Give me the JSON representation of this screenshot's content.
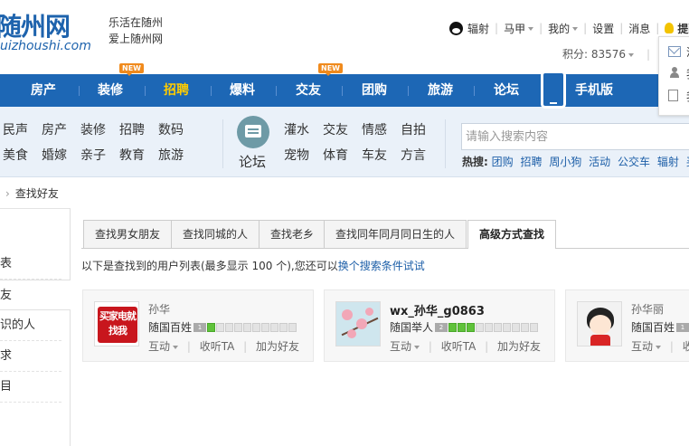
{
  "header": {
    "logo_main": "随州网",
    "logo_sub": "uizhoushi.com",
    "slogan_line1": "乐活在随州",
    "slogan_line2": "爱上随州网",
    "user": {
      "qq_name": "辐射",
      "username": "马甲",
      "mine": "我的",
      "settings": "设置",
      "messages": "消息",
      "reminder": "提醒",
      "points": "积分: 83576"
    },
    "dropdown": {
      "item1": "消",
      "item2": "我",
      "item3": "我"
    }
  },
  "nav": {
    "items": [
      {
        "label": "房产"
      },
      {
        "label": "装修",
        "badge": "NEW"
      },
      {
        "label": "招聘",
        "active": true
      },
      {
        "label": "爆料"
      },
      {
        "label": "交友",
        "badge": "NEW"
      },
      {
        "label": "团购"
      },
      {
        "label": "旅游"
      },
      {
        "label": "论坛"
      },
      {
        "label": "手机版"
      }
    ]
  },
  "subnav": {
    "row1": [
      "民声",
      "房产",
      "装修",
      "招聘",
      "数码"
    ],
    "row2": [
      "美食",
      "婚嫁",
      "亲子",
      "教育",
      "旅游"
    ],
    "forum_label": "论坛",
    "forum_row1": [
      "灌水",
      "交友",
      "情感",
      "自拍"
    ],
    "forum_row2": [
      "宠物",
      "体育",
      "车友",
      "方言"
    ],
    "search_placeholder": "请输入搜索内容",
    "hot_label": "热搜:",
    "hot_links": [
      "团购",
      "招聘",
      "周小狗",
      "活动",
      "公交车",
      "辐射",
      "买房"
    ]
  },
  "breadcrumb": {
    "sep": "›",
    "current": "查找好友"
  },
  "sidebar": {
    "items": [
      {
        "label": "表"
      },
      {
        "label": "友",
        "active": true
      },
      {
        "label": "识的人"
      },
      {
        "label": "求"
      },
      {
        "label": "目"
      }
    ]
  },
  "tabs": [
    {
      "label": "查找男女朋友"
    },
    {
      "label": "查找同城的人"
    },
    {
      "label": "查找老乡"
    },
    {
      "label": "查找同年同月同日生的人"
    },
    {
      "label": "高级方式查找",
      "active": true
    }
  ],
  "result_note": {
    "text": "以下是查找到的用户列表(最多显示 100 个),您还可以",
    "link": "换个搜索条件试试"
  },
  "users": [
    {
      "name": "孙华",
      "rank": "随国百姓",
      "level": "1",
      "level_fill": 0.1,
      "avatar_text": "买家电就找我",
      "action_interact": "互动",
      "action_follow": "收听TA",
      "action_add": "加为好友"
    },
    {
      "name": "wx_孙华_g0863",
      "rank": "随国举人",
      "level": "2",
      "level_fill": 0.3,
      "action_interact": "互动",
      "action_follow": "收听TA",
      "action_add": "加为好友"
    },
    {
      "name": "孙华丽",
      "rank": "随国百姓",
      "level": "1",
      "action_interact": "互动",
      "action_follow": "收"
    }
  ],
  "colors": {
    "nav_bg": "#1d67b5",
    "nav_active": "#ffcc00",
    "link": "#1d5fa8",
    "subnav_bg": "#eaf1f9",
    "badge": "#f08a1c"
  }
}
